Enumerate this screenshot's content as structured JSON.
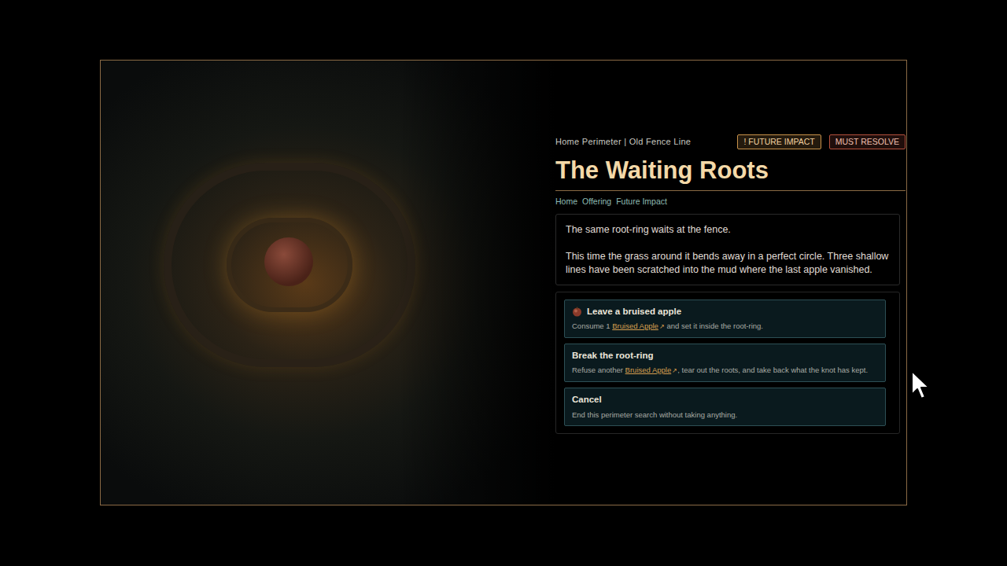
{
  "location": "Home Perimeter | Old Fence Line",
  "badges": [
    {
      "label": "! FUTURE IMPACT",
      "color": "#c8924a"
    },
    {
      "label": "MUST RESOLVE",
      "color": "#b4503c"
    }
  ],
  "title": "The Waiting Roots",
  "tags": [
    "Home",
    "Offering",
    "Future Impact"
  ],
  "description": [
    "The same root-ring waits at the fence.",
    "This time the grass around it bends away in a perfect circle. Three shallow lines have been scratched into the mud where the last apple vanished."
  ],
  "choices": [
    {
      "kind": "item",
      "title": "Leave a bruised apple",
      "detail": [
        {
          "text": "Consume 1 ",
          "link": false
        },
        {
          "text": "Bruised Apple",
          "link": true,
          "icon": "↗"
        },
        {
          "text": " and set it inside the root-ring.",
          "link": false
        }
      ]
    },
    {
      "kind": "action",
      "title": "Break the root-ring",
      "detail": [
        {
          "text": "Refuse another ",
          "link": false
        },
        {
          "text": "Bruised Apple",
          "link": true,
          "icon": "↗"
        },
        {
          "text": ", tear out the roots, and take back what the knot has kept.",
          "link": false
        }
      ]
    },
    {
      "kind": "action",
      "title": "Cancel",
      "detail": [
        {
          "text": "End this perimeter search without taking anything.",
          "link": false
        }
      ]
    }
  ]
}
